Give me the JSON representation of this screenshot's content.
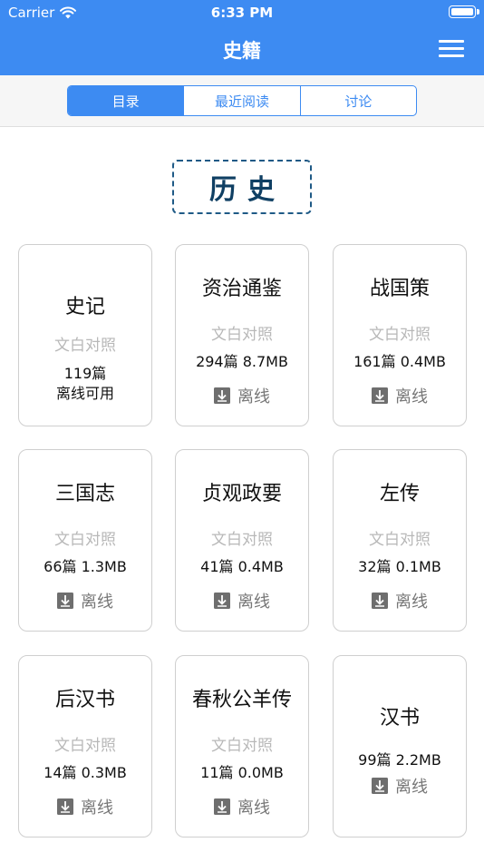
{
  "status_bar": {
    "carrier": "Carrier",
    "time": "6:33 PM"
  },
  "nav": {
    "title": "史籍"
  },
  "tabs": [
    {
      "label": "目录",
      "active": true
    },
    {
      "label": "最近阅读",
      "active": false
    },
    {
      "label": "讨论",
      "active": false
    }
  ],
  "section": {
    "title": "历史"
  },
  "books": [
    {
      "title": "史记",
      "subtitle": "文白对照",
      "info": "119篇",
      "status": "离线可用"
    },
    {
      "title": "资治通鉴",
      "subtitle": "文白对照",
      "info": "294篇 8.7MB",
      "download_label": "离线"
    },
    {
      "title": "战国策",
      "subtitle": "文白对照",
      "info": "161篇 0.4MB",
      "download_label": "离线"
    },
    {
      "title": "三国志",
      "subtitle": "文白对照",
      "info": "66篇 1.3MB",
      "download_label": "离线"
    },
    {
      "title": "贞观政要",
      "subtitle": "文白对照",
      "info": "41篇 0.4MB",
      "download_label": "离线"
    },
    {
      "title": "左传",
      "subtitle": "文白对照",
      "info": "32篇 0.1MB",
      "download_label": "离线"
    },
    {
      "title": "后汉书",
      "subtitle": "文白对照",
      "info": "14篇 0.3MB",
      "download_label": "离线"
    },
    {
      "title": "春秋公羊传",
      "subtitle": "文白对照",
      "info": "11篇 0.0MB",
      "download_label": "离线"
    },
    {
      "title": "汉书",
      "info": "99篇 2.2MB",
      "download_label": "离线"
    }
  ],
  "colors": {
    "accent": "#3d8bf2",
    "section_border": "#1f5a86",
    "muted_text": "#b8b8b8"
  },
  "icons": {
    "wifi": "wifi-icon",
    "battery": "battery-icon",
    "menu": "menu-icon",
    "download": "download-icon"
  }
}
